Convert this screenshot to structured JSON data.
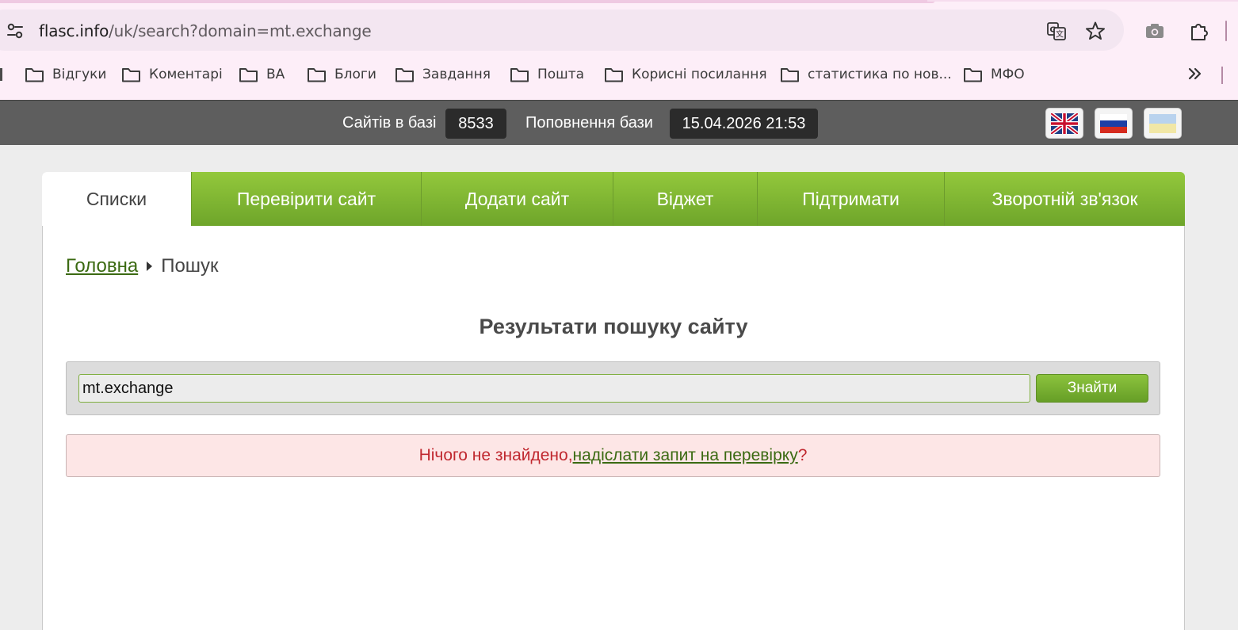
{
  "browser": {
    "url_host": "flasc.info",
    "url_path": "/uk/search?domain=mt.exchange",
    "bookmarks": [
      {
        "label": "Відгуки"
      },
      {
        "label": "Коментарі"
      },
      {
        "label": "ВА"
      },
      {
        "label": "Блоги"
      },
      {
        "label": "Завдання"
      },
      {
        "label": "Пошта"
      },
      {
        "label": "Корисні посилання"
      },
      {
        "label": "статистика по нов..."
      },
      {
        "label": "МФО"
      }
    ]
  },
  "topbar": {
    "sites_label": "Сайтів в базі",
    "sites_count": "8533",
    "update_label": "Поповнення бази",
    "update_value": "15.04.2026 21:53",
    "languages": [
      "english-flag-icon",
      "russian-flag-icon",
      "ukrainian-flag-icon"
    ]
  },
  "tabs": [
    {
      "label": "Списки",
      "active": true
    },
    {
      "label": "Перевірити сайт"
    },
    {
      "label": "Додати сайт"
    },
    {
      "label": "Віджет"
    },
    {
      "label": "Підтримати"
    },
    {
      "label": "Зворотній зв'язок"
    }
  ],
  "breadcrumb": {
    "home": "Головна",
    "current": "Пошук"
  },
  "page_title": "Результати пошуку сайту",
  "search": {
    "value": "mt.exchange",
    "button_label": "Знайти"
  },
  "alert": {
    "text": "Нічого не знайдено, ",
    "link": "надіслати запит на перевірку",
    "suffix": "?"
  },
  "colors": {
    "accent_green": "#7db536",
    "topbar": "#5e5e5e",
    "alert_bg": "#fde6e6",
    "alert_text": "#c0282f"
  }
}
